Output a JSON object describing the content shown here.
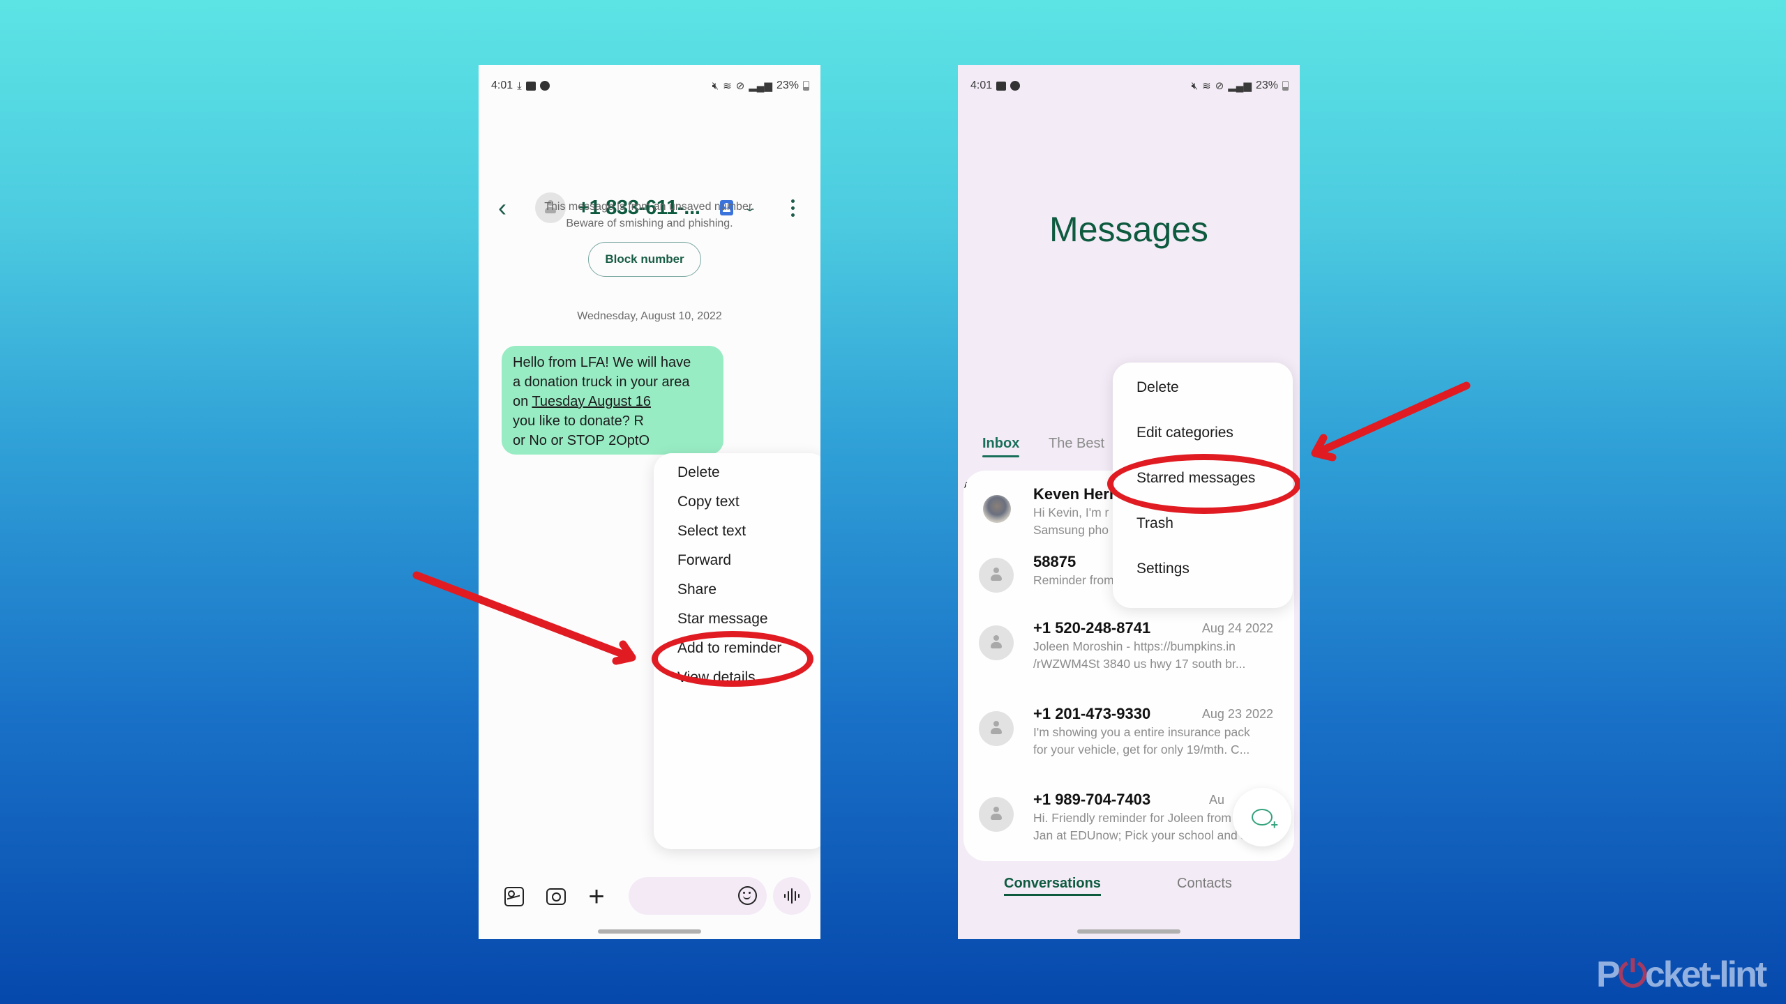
{
  "left_phone": {
    "status_bar": {
      "time": "4:01",
      "left_icons": [
        "download-icon",
        "image-icon",
        "account-circle-icon"
      ],
      "right_icons": [
        "mute-icon",
        "wifi-6e-icon",
        "do-not-disturb-icon",
        "signal-icon"
      ],
      "battery": "23%"
    },
    "header": {
      "contact_name": "+1 833-611-...",
      "back_icon": "chevron-left-icon",
      "contact_icon": "contact-card-icon",
      "expand_icon": "chevron-down-icon",
      "more_icon": "more-vertical-icon"
    },
    "notice": {
      "line1": "This message is from an unsaved number.",
      "line2": "Beware of smishing and phishing.",
      "block_button": "Block number"
    },
    "date_divider": "Wednesday, August 10, 2022",
    "message": {
      "line1": "Hello from LFA! We will have",
      "line2": "a donation truck in your area",
      "line3_prefix": "on ",
      "line3_link": "Tuesday August 16",
      "line4": "you like to donate? R",
      "line5": "or No or STOP 2OptO",
      "bubble_color": "#98ecc4"
    },
    "context_menu": {
      "items": [
        "Delete",
        "Copy text",
        "Select text",
        "Forward",
        "Share",
        "Star message",
        "Add to reminder",
        "View details"
      ],
      "highlighted": "Star message"
    },
    "compose": {
      "icons": [
        "gallery-icon",
        "camera-icon",
        "plus-icon",
        "emoji-icon",
        "voice-icon"
      ],
      "placeholder": ""
    }
  },
  "right_phone": {
    "status_bar": {
      "time": "4:01",
      "left_icons": [
        "image-icon",
        "account-circle-icon"
      ],
      "right_icons": [
        "mute-icon",
        "wifi-6e-icon",
        "do-not-disturb-icon",
        "signal-icon"
      ],
      "battery": "23%"
    },
    "title": "Messages",
    "category_tabs": [
      {
        "label": "Inbox",
        "active": true
      },
      {
        "label": "The Best",
        "active": false
      }
    ],
    "context_menu": {
      "items": [
        "Delete",
        "Edit categories",
        "Starred messages",
        "Trash",
        "Settings"
      ],
      "highlighted": "Starred messages"
    },
    "conversations": [
      {
        "name": "Keven Herr",
        "date": "",
        "preview1": "Hi Kevin, I'm r",
        "preview2": "Samsung pho",
        "avatar": "photo"
      },
      {
        "name": "58875",
        "date": "",
        "preview1": "Reminder from Alexa: Jeremiah",
        "preview2": "",
        "avatar": "default"
      },
      {
        "name": "+1 520-248-8741",
        "date": "Aug 24 2022",
        "preview1": "Joleen Moroshin - https://bumpkins.in",
        "preview2": "/rWZWM4St 3840 us hwy 17 south br...",
        "avatar": "default"
      },
      {
        "name": "+1 201-473-9330",
        "date": "Aug 23 2022",
        "preview1": "I'm showing you a entire insurance pack",
        "preview2": "for your vehicle, get for only 19/mth. C...",
        "avatar": "default"
      },
      {
        "name": "+1 989-704-7403",
        "date": "Au",
        "preview1": "Hi. Friendly reminder for Joleen from",
        "preview2": "Jan at EDUnow; Pick your school and s...",
        "avatar": "default"
      }
    ],
    "fab_icon": "new-chat-icon",
    "bottom_tabs": [
      {
        "label": "Conversations",
        "active": true
      },
      {
        "label": "Contacts",
        "active": false
      }
    ]
  },
  "annotations": {
    "arrow_color": "#e01b22",
    "ring_color": "#e01b22"
  },
  "brand": {
    "prefix": "P",
    "o": "o",
    "suffix": "cket-lint"
  },
  "colors": {
    "accent_green": "#0d5a3f",
    "background_top": "#5ce4e4",
    "background_bottom": "#0648ac"
  }
}
